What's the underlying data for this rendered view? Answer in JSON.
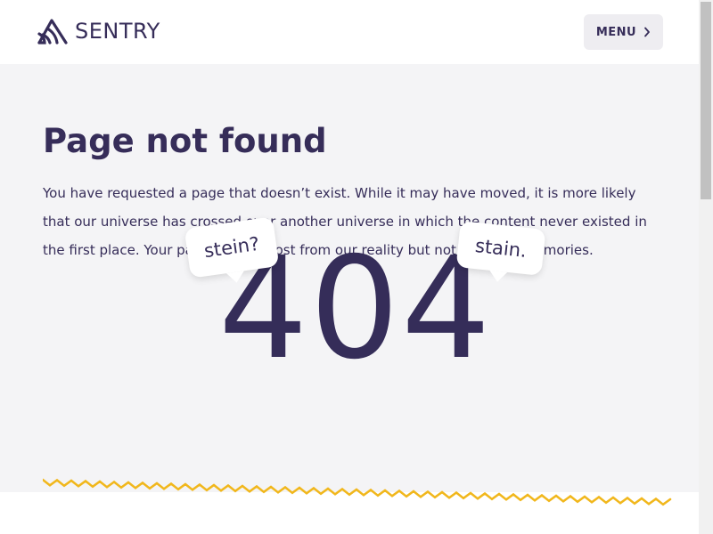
{
  "header": {
    "logo_text": "SENTRY",
    "menu_label": "MENU"
  },
  "main": {
    "title": "Page not found",
    "description": "You have requested a page that doesn’t exist. While it may have moved, it is more likely that our universe has crossed over another universe in which the content never existed in the first place. Your page as been lost from our reality but not from our memories.",
    "error_code": "404",
    "bubble_left": "stein?",
    "bubble_right": "stain."
  },
  "colors": {
    "brand": "#362d59",
    "wave": "#f1b71c",
    "page_bg": "#f4f4f6",
    "menu_bg": "#eeedf1"
  },
  "icons": {
    "logo": "sentry-logo-icon",
    "menu_chevron": "chevron-right-icon"
  }
}
